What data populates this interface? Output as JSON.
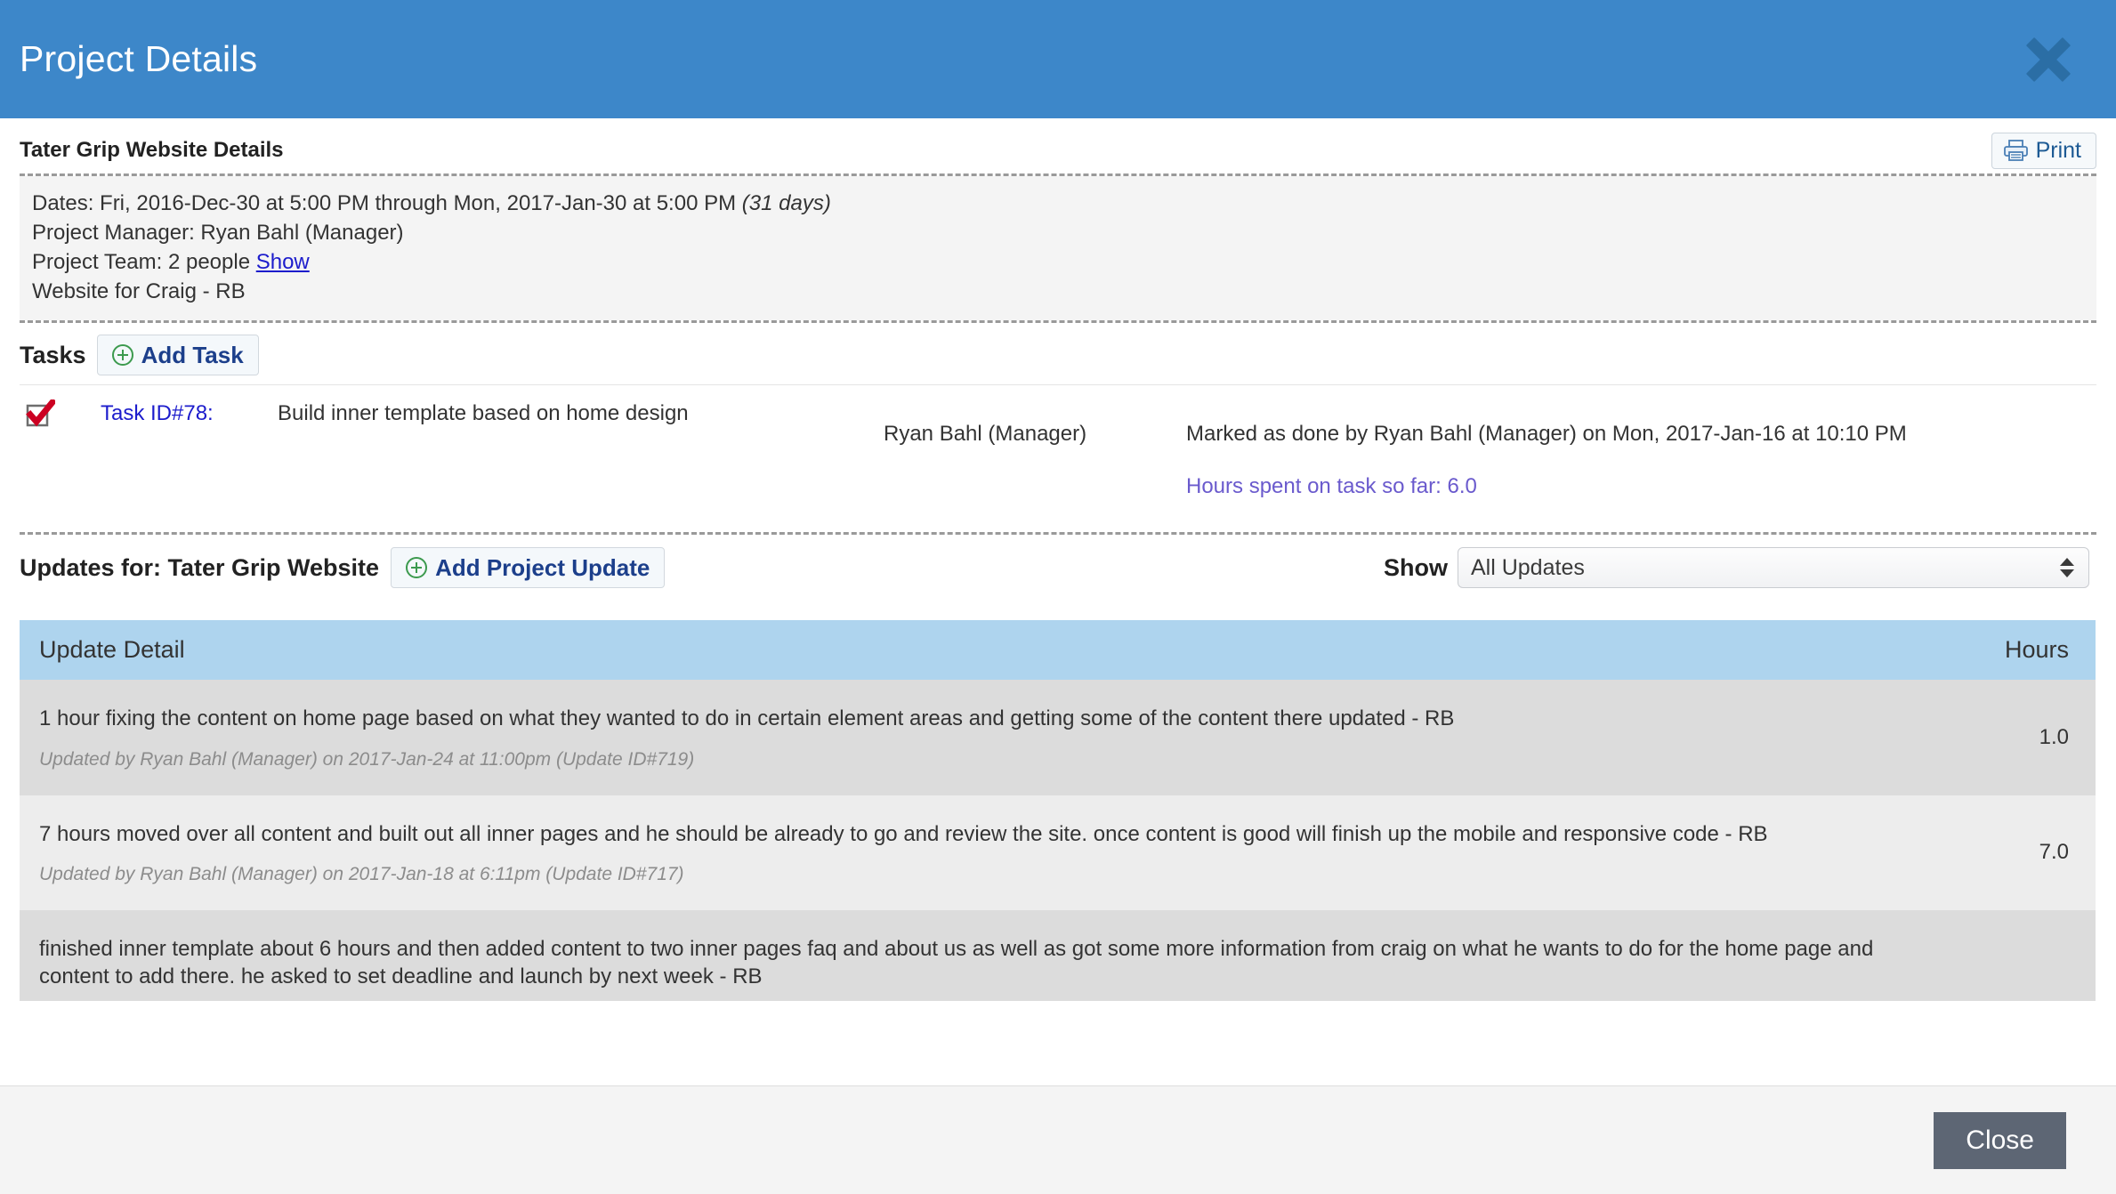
{
  "header": {
    "title": "Project Details",
    "close_icon": "close-x-icon"
  },
  "subtitle_row": {
    "subtitle": "Tater Grip Website Details",
    "print_label": "Print",
    "print_icon": "printer-icon"
  },
  "info": {
    "dates_line": "Dates: Fri, 2016-Dec-30 at 5:00 PM through Mon, 2017-Jan-30 at 5:00 PM",
    "dates_duration": "(31 days)",
    "manager_line": "Project Manager: Ryan Bahl (Manager)",
    "team_line": "Project Team: 2 people",
    "team_show_link": "Show",
    "description": "Website for Craig - RB"
  },
  "tasks": {
    "section_label": "Tasks",
    "add_task_label": "Add Task",
    "add_icon": "plus-circle-icon",
    "rows": [
      {
        "status_icon": "checked-checkbox-icon",
        "task_id": "Task ID#78:",
        "name": "Build inner template based on home design",
        "assignee": "Ryan Bahl (Manager)",
        "done_note": "Marked as done by Ryan Bahl (Manager) on Mon, 2017-Jan-16 at 10:10 PM",
        "hours_note": "Hours spent on task so far: 6.0"
      }
    ]
  },
  "updates": {
    "title": "Updates for: Tater Grip Website",
    "add_update_label": "Add Project Update",
    "add_icon": "plus-circle-icon",
    "show_label": "Show",
    "filter_selected": "All Updates",
    "filter_options": [
      "All Updates"
    ],
    "columns": {
      "detail": "Update Detail",
      "hours": "Hours"
    },
    "rows": [
      {
        "text": "1 hour fixing the content on home page based on what they wanted to do in certain element areas and getting some of the content there updated - RB",
        "meta": "Updated by Ryan Bahl (Manager) on 2017-Jan-24 at 11:00pm (Update ID#719)",
        "hours": "1.0"
      },
      {
        "text": "7 hours moved over all content and built out all inner pages and he should be already to go and review the site. once content is good will finish up the mobile and responsive code - RB",
        "meta": "Updated by Ryan Bahl (Manager) on 2017-Jan-18 at 6:11pm (Update ID#717)",
        "hours": "7.0"
      },
      {
        "text": "finished inner template about 6 hours and then added content to two inner pages faq and about us as well as got some more information from craig on what he wants to do for the home page and content to add there. he asked to set deadline and launch by next week - RB",
        "meta": "",
        "hours": ""
      }
    ]
  },
  "footer": {
    "close_label": "Close"
  },
  "colors": {
    "header_blue": "#3d87c9",
    "table_header_blue": "#aed4ee",
    "link_blue": "#1c1ccc",
    "hours_purple": "#6a5acd",
    "close_button_gray": "#5d6674"
  }
}
